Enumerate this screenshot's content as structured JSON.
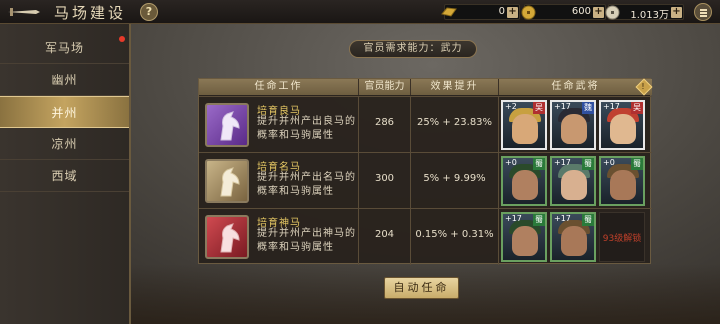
{
  "title": "马场建设",
  "help_label": "?",
  "resources": [
    {
      "icon": "gold-bar-icon",
      "value": "0"
    },
    {
      "icon": "copper-coin-icon",
      "value": "600"
    },
    {
      "icon": "silver-coin-icon",
      "value": "1.013万"
    }
  ],
  "sidebar": {
    "items": [
      {
        "label": "军马场",
        "active": false,
        "badge": true
      },
      {
        "label": "幽州",
        "active": false
      },
      {
        "label": "并州",
        "active": true
      },
      {
        "label": "凉州",
        "active": false
      },
      {
        "label": "西域",
        "active": false
      }
    ]
  },
  "requirement": "官员需求能力：武力",
  "table": {
    "headers": [
      "任命工作",
      "官员能力",
      "效果提升",
      "任命武将"
    ],
    "info_label": "!",
    "rows": [
      {
        "name": "培育良马",
        "desc": "提升并州产出良马的概率和马驹属性",
        "ability": "286",
        "effect": "25% + 23.83%",
        "emblem_color": "#7a4aa8",
        "generals": [
          {
            "level": "+2",
            "faction": "吴",
            "faction_color": "#b03030"
          },
          {
            "level": "+17",
            "faction": "魏",
            "faction_color": "#3050a0"
          },
          {
            "level": "+17",
            "faction": "吴",
            "faction_color": "#b03030"
          }
        ]
      },
      {
        "name": "培育名马",
        "desc": "提升并州产出名马的概率和马驹属性",
        "ability": "300",
        "effect": "5% + 9.99%",
        "emblem_color": "#a08a60",
        "generals": [
          {
            "level": "+0",
            "faction": "蜀",
            "faction_color": "#2a7a3a"
          },
          {
            "level": "+17",
            "faction": "蜀",
            "faction_color": "#2a7a3a"
          },
          {
            "level": "+0",
            "faction": "蜀",
            "faction_color": "#2a7a3a"
          }
        ]
      },
      {
        "name": "培育神马",
        "desc": "提升并州产出神马的概率和马驹属性",
        "ability": "204",
        "effect": "0.15% + 0.31%",
        "emblem_color": "#b03038",
        "generals": [
          {
            "level": "+17",
            "faction": "蜀",
            "faction_color": "#2a7a3a"
          },
          {
            "level": "+17",
            "faction": "蜀",
            "faction_color": "#2a7a3a"
          }
        ],
        "locked_slot": "93级解锁"
      }
    ]
  },
  "auto_button": "自动任命"
}
